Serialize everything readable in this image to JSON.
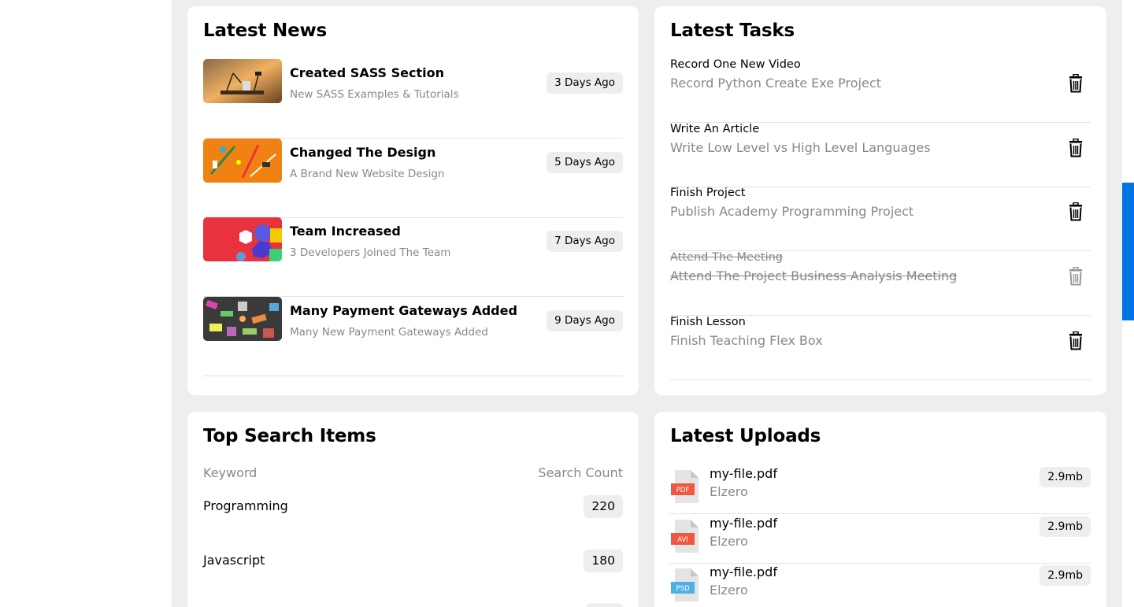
{
  "news": {
    "title": "Latest News",
    "items": [
      {
        "title": "Created SASS Section",
        "desc": "New SASS Examples & Tutorials",
        "badge": "3 Days Ago",
        "thumb": "desk-lamp-image"
      },
      {
        "title": "Changed The Design",
        "desc": "A Brand New Website Design",
        "badge": "5 Days Ago",
        "thumb": "stationery-image"
      },
      {
        "title": "Team Increased",
        "desc": "3 Developers Joined The Team",
        "badge": "7 Days Ago",
        "thumb": "shapes-image"
      },
      {
        "title": "Many Payment Gateways Added",
        "desc": "Many New Payment Gateways Added",
        "badge": "9 Days Ago",
        "thumb": "gadgets-image"
      }
    ]
  },
  "tasks": {
    "title": "Latest Tasks",
    "items": [
      {
        "title": "Record One New Video",
        "desc": "Record Python Create Exe Project",
        "done": false
      },
      {
        "title": "Write An Article",
        "desc": "Write Low Level vs High Level Languages",
        "done": false
      },
      {
        "title": "Finish Project",
        "desc": "Publish Academy Programming Project",
        "done": false
      },
      {
        "title": "Attend The Meeting",
        "desc": "Attend The Project Business Analysis Meeting",
        "done": true
      },
      {
        "title": "Finish Lesson",
        "desc": "Finish Teaching Flex Box",
        "done": false
      }
    ]
  },
  "search": {
    "title": "Top Search Items",
    "col_keyword": "Keyword",
    "col_count": "Search Count",
    "rows": [
      {
        "keyword": "Programming",
        "count": "220"
      },
      {
        "keyword": "Javascript",
        "count": "180"
      }
    ]
  },
  "uploads": {
    "title": "Latest Uploads",
    "items": [
      {
        "name": "my-file.pdf",
        "owner": "Elzero",
        "size": "2.9mb",
        "type": "PDF",
        "type_color": "#f0573f"
      },
      {
        "name": "my-file.pdf",
        "owner": "Elzero",
        "size": "2.9mb",
        "type": "AVI",
        "type_color": "#f0573f"
      },
      {
        "name": "my-file.pdf",
        "owner": "Elzero",
        "size": "2.9mb",
        "type": "PSD",
        "type_color": "#4fb0e3"
      }
    ]
  },
  "colors": {
    "accent": "#0075e3",
    "background": "#eeeeee"
  }
}
